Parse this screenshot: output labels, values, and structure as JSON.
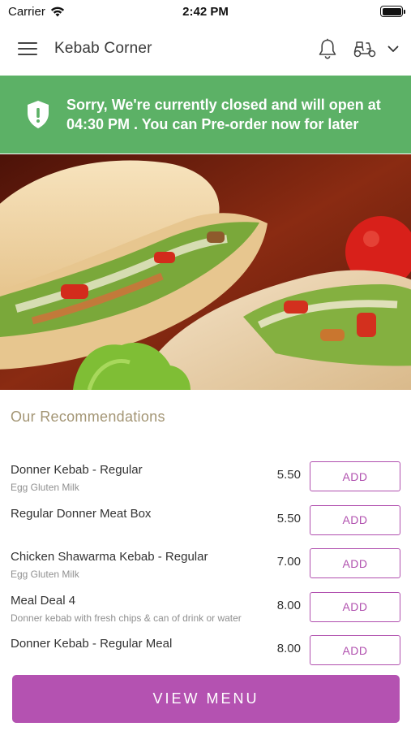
{
  "status_bar": {
    "carrier": "Carrier",
    "time": "2:42 PM"
  },
  "header": {
    "title": "Kebab Corner",
    "icons": [
      "hamburger-menu-icon",
      "bell-icon",
      "delivery-scooter-icon",
      "chevron-down-icon"
    ]
  },
  "banner": {
    "message": "Sorry, We're currently closed and will open at 04:30 PM . You can Pre-order now for later",
    "background": "#5cb166",
    "icon": "shield-alert-icon"
  },
  "hero": {
    "description": "kebab-wraps-photo"
  },
  "recommendations": {
    "title": "Our Recommendations",
    "add_label": "ADD",
    "items": [
      {
        "name": "Donner Kebab - Regular",
        "sub": "Egg  Gluten  Milk",
        "price": "5.50"
      },
      {
        "name": "Regular Donner Meat Box",
        "sub": "",
        "price": "5.50"
      },
      {
        "name": "Chicken Shawarma Kebab - Regular",
        "sub": "Egg  Gluten  Milk",
        "price": "7.00"
      },
      {
        "name": "Meal Deal 4",
        "sub": "Donner kebab with fresh chips & can of drink or water",
        "price": "8.00"
      },
      {
        "name": "Donner Kebab - Regular Meal",
        "sub": "",
        "price": "8.00"
      }
    ]
  },
  "footer": {
    "view_menu_label": "VIEW MENU",
    "accent": "#b452b1"
  }
}
